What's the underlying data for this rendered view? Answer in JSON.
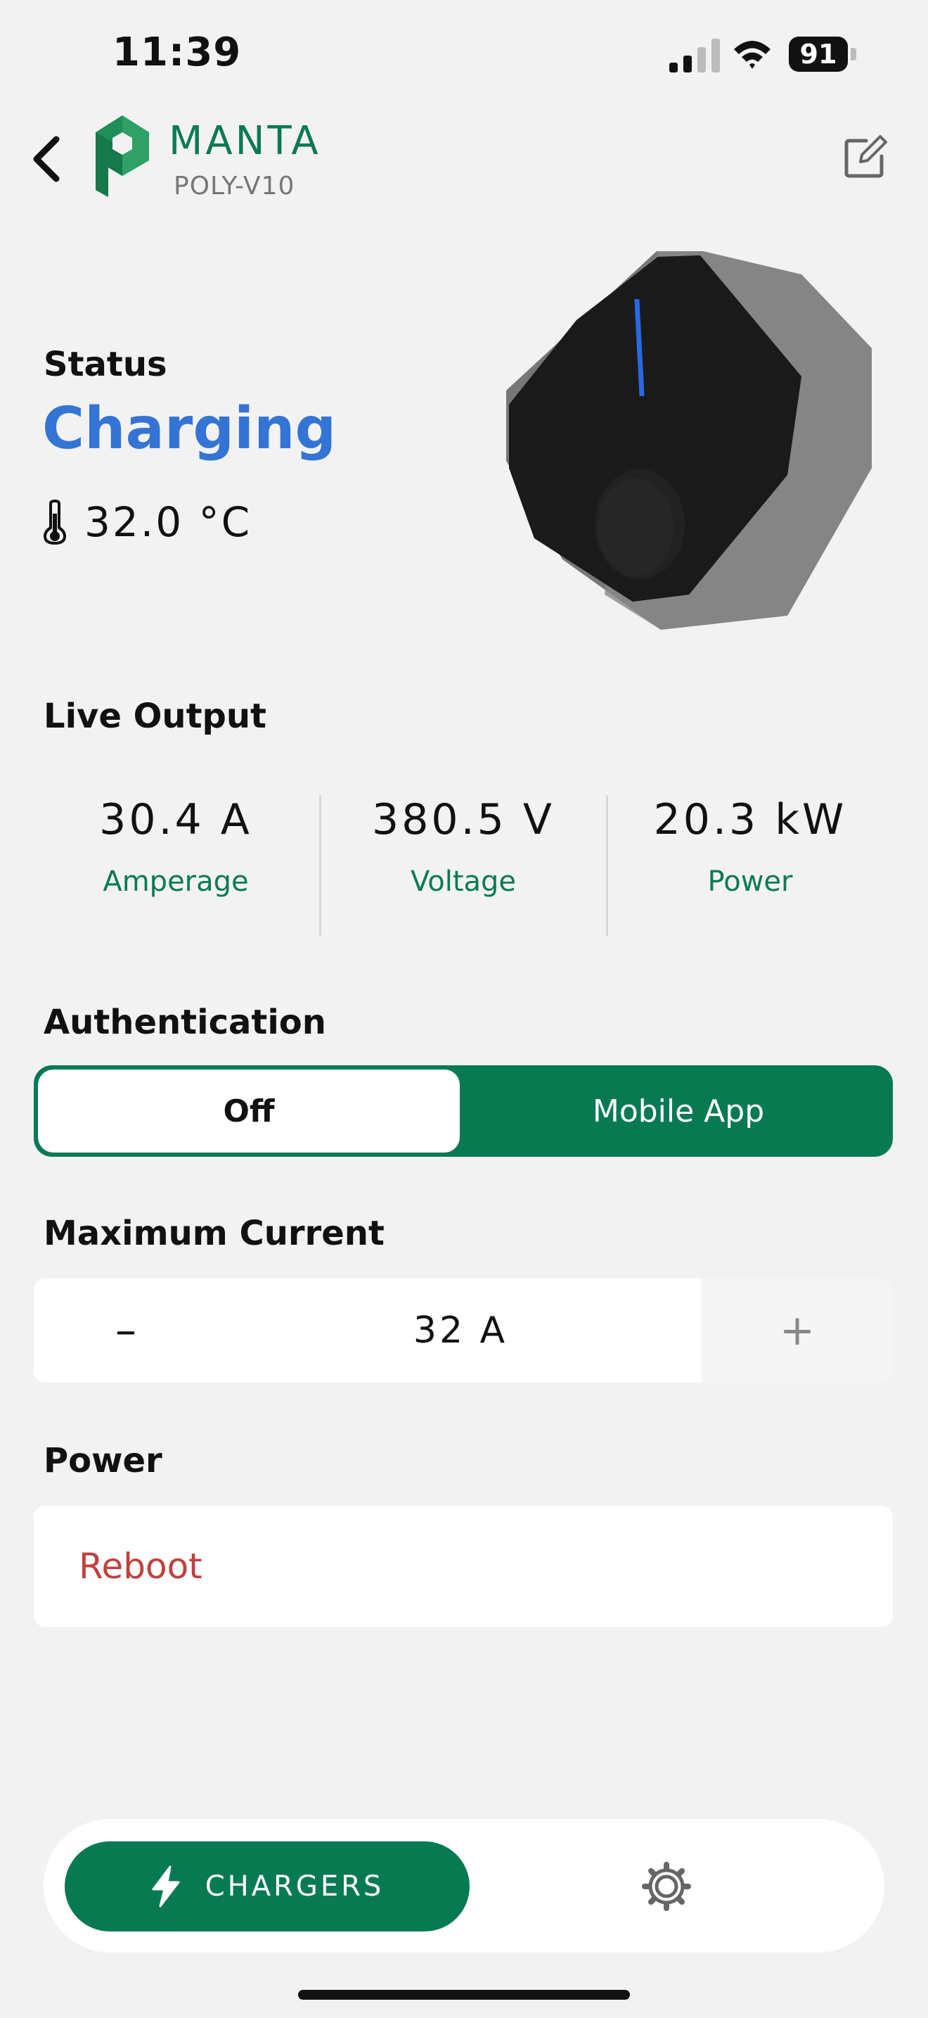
{
  "status_bar": {
    "time": "11:39",
    "battery": "91"
  },
  "header": {
    "brand": "MANTA",
    "model": "POLY-V10"
  },
  "status": {
    "label": "Status",
    "value": "Charging",
    "temperature": "32.0 °C"
  },
  "live_output": {
    "title": "Live Output",
    "stats": [
      {
        "value": "30.4 A",
        "label": "Amperage"
      },
      {
        "value": "380.5 V",
        "label": "Voltage"
      },
      {
        "value": "20.3 kW",
        "label": "Power"
      }
    ]
  },
  "authentication": {
    "title": "Authentication",
    "options": [
      "Off",
      "Mobile App"
    ],
    "selected": "Off"
  },
  "max_current": {
    "title": "Maximum Current",
    "value": "32 A",
    "decrement": "–",
    "increment": "+"
  },
  "power": {
    "title": "Power",
    "action": "Reboot"
  },
  "tabbar": {
    "chargers_label": "CHARGERS"
  },
  "colors": {
    "brand_green": "#087a52",
    "status_blue": "#3474d4",
    "danger_red": "#c0403e"
  }
}
